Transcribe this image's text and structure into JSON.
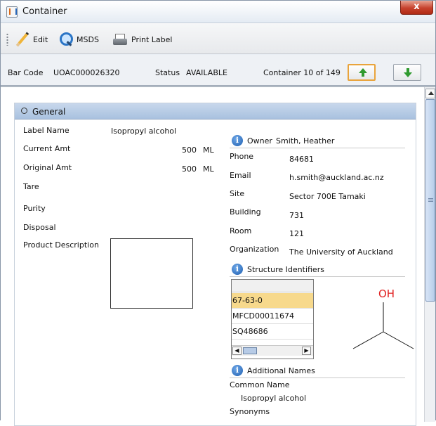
{
  "window": {
    "title": "Container",
    "close_label": "x"
  },
  "toolbar": {
    "edit_label": "Edit",
    "msds_label": "MSDS",
    "print_label": "Print Label"
  },
  "infobar": {
    "barcode_label": "Bar Code",
    "barcode_value": "UOAC000026320",
    "status_label": "Status",
    "status_value": "AVAILABLE",
    "position_text": "Container 10 of 149"
  },
  "general": {
    "header": "General",
    "label_name_label": "Label Name",
    "label_name_value": "Isopropyl alcohol",
    "current_amt_label": "Current Amt",
    "current_amt_value": "500",
    "current_amt_unit": "ML",
    "original_amt_label": "Original Amt",
    "original_amt_value": "500",
    "original_amt_unit": "ML",
    "tare_label": "Tare",
    "purity_label": "Purity",
    "disposal_label": "Disposal",
    "product_description_label": "Product Description"
  },
  "owner": {
    "header_label": "Owner",
    "name": "Smith, Heather",
    "phone_label": "Phone",
    "phone_value": "84681",
    "email_label": "Email",
    "email_value": "h.smith@auckland.ac.nz",
    "site_label": "Site",
    "site_value": "Sector 700E Tamaki",
    "building_label": "Building",
    "building_value": "731",
    "room_label": "Room",
    "room_value": "121",
    "organization_label": "Organization",
    "organization_value": "The University of Auckland"
  },
  "structure": {
    "header": "Structure Identifiers",
    "identifiers": [
      "67-63-0",
      "MFCD00011674",
      "SQ48686"
    ],
    "selected_index": 0,
    "hydroxyl_label": "OH"
  },
  "additional": {
    "header": "Additional Names",
    "common_name_label": "Common Name",
    "common_name_value": "Isopropyl alcohol",
    "synonyms_label": "Synonyms"
  },
  "colors": {
    "header_blue": "#a9c1df",
    "selected_row": "#f7d98c",
    "arrow_green": "#2f9a2f",
    "hydroxyl_red": "#e02020"
  }
}
